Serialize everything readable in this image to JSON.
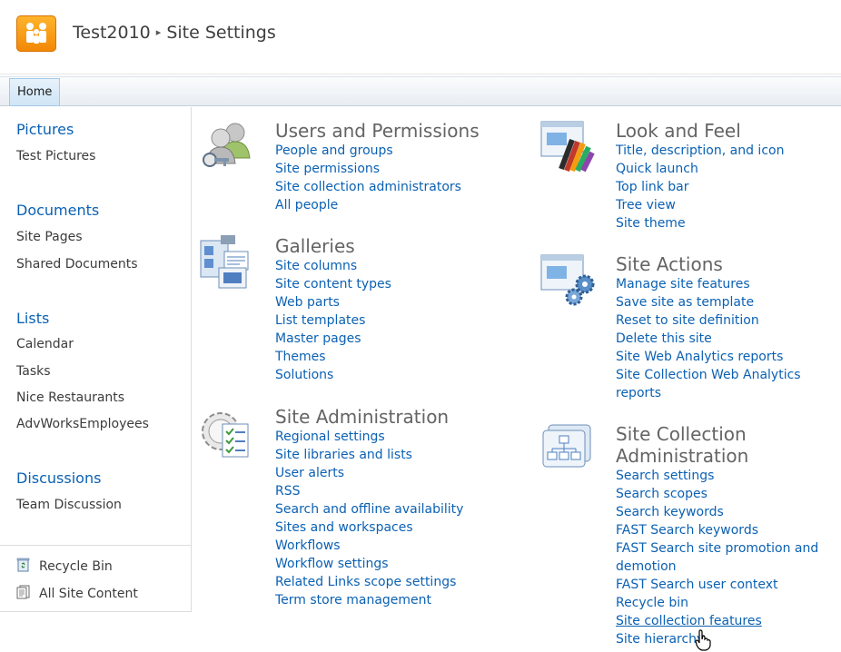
{
  "header": {
    "site_name": "Test2010",
    "separator": "▸",
    "page_title": "Site Settings"
  },
  "topnav": {
    "home_label": "Home"
  },
  "quicklaunch": {
    "pictures_heading": "Pictures",
    "pictures_items": [
      "Test Pictures"
    ],
    "documents_heading": "Documents",
    "documents_items": [
      "Site Pages",
      "Shared Documents"
    ],
    "lists_heading": "Lists",
    "lists_items": [
      "Calendar",
      "Tasks",
      "Nice Restaurants",
      "AdvWorksEmployees"
    ],
    "discussions_heading": "Discussions",
    "discussions_items": [
      "Team Discussion"
    ],
    "recycle_bin": "Recycle Bin",
    "all_site_content": "All Site Content"
  },
  "sections": {
    "users": {
      "title": "Users and Permissions",
      "links": [
        "People and groups",
        "Site permissions",
        "Site collection administrators",
        "All people"
      ]
    },
    "galleries": {
      "title": "Galleries",
      "links": [
        "Site columns",
        "Site content types",
        "Web parts",
        "List templates",
        "Master pages",
        "Themes",
        "Solutions"
      ]
    },
    "admin": {
      "title": "Site Administration",
      "links": [
        "Regional settings",
        "Site libraries and lists",
        "User alerts",
        "RSS",
        "Search and offline availability",
        "Sites and workspaces",
        "Workflows",
        "Workflow settings",
        "Related Links scope settings",
        "Term store management"
      ]
    },
    "look": {
      "title": "Look and Feel",
      "links": [
        "Title, description, and icon",
        "Quick launch",
        "Top link bar",
        "Tree view",
        "Site theme"
      ]
    },
    "actions": {
      "title": "Site Actions",
      "links": [
        "Manage site features",
        "Save site as template",
        "Reset to site definition",
        "Delete this site",
        "Site Web Analytics reports",
        "Site Collection Web Analytics reports"
      ]
    },
    "collection": {
      "title": "Site Collection Administration",
      "links": [
        "Search settings",
        "Search scopes",
        "Search keywords",
        "FAST Search keywords",
        "FAST Search site promotion and demotion",
        "FAST Search user context",
        "Recycle bin",
        "Site collection features",
        "Site hierarchy"
      ]
    }
  },
  "icons": {
    "logo": "people-logo-icon",
    "users": "users-keys-icon",
    "galleries": "galleries-icon",
    "admin": "gear-checklist-icon",
    "look": "window-palette-icon",
    "actions": "window-gears-icon",
    "collection": "hierarchy-icon",
    "recycle": "recycle-bin-icon",
    "content": "all-content-icon",
    "cursor": "hand-cursor-icon"
  },
  "colors": {
    "link": "#0b61b3",
    "heading": "#646464",
    "logo": "#f28705"
  }
}
